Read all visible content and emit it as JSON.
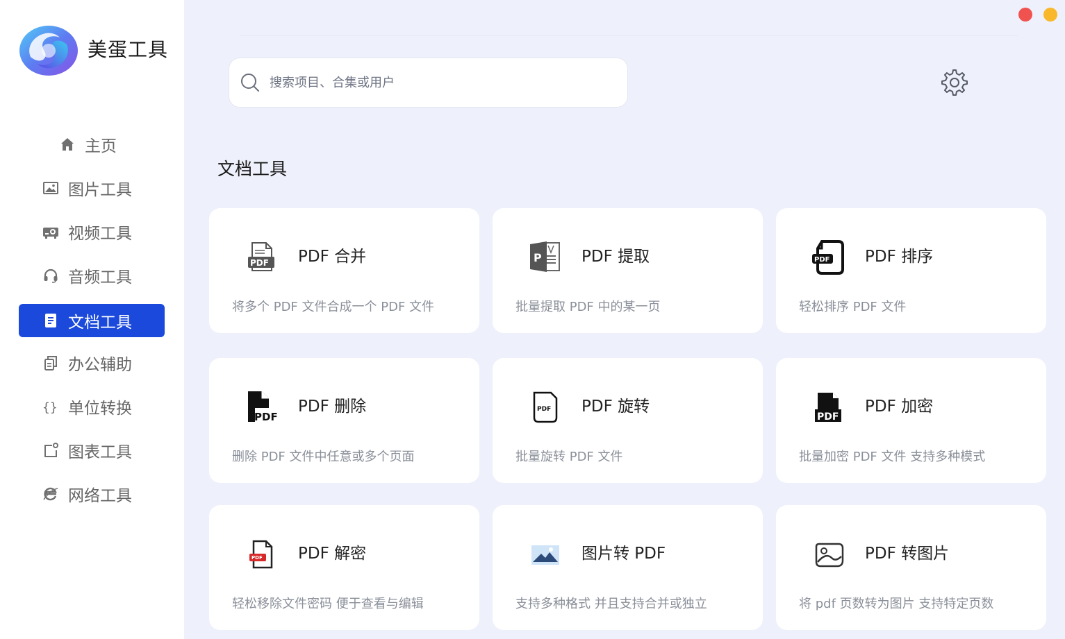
{
  "app": {
    "title": "美蛋工具"
  },
  "nav": [
    {
      "label": "主页",
      "icon": "home-icon"
    },
    {
      "label": "图片工具",
      "icon": "image-icon"
    },
    {
      "label": "视频工具",
      "icon": "video-icon"
    },
    {
      "label": "音频工具",
      "icon": "headphones-icon"
    },
    {
      "label": "文档工具",
      "icon": "document-icon",
      "active": true
    },
    {
      "label": "办公辅助",
      "icon": "copy-icon"
    },
    {
      "label": "单位转换",
      "icon": "braces-icon"
    },
    {
      "label": "图表工具",
      "icon": "chart-icon"
    },
    {
      "label": "网络工具",
      "icon": "browser-icon"
    }
  ],
  "search": {
    "placeholder": "搜索项目、合集或用户"
  },
  "section": {
    "title": "文档工具"
  },
  "tools": [
    {
      "title": "PDF 合并",
      "desc": "将多个 PDF 文件合成一个 PDF 文件",
      "icon": "pdf-merge-icon"
    },
    {
      "title": "PDF 提取",
      "desc": "批量提取 PDF 中的某一页",
      "icon": "pdf-extract-icon"
    },
    {
      "title": "PDF 排序",
      "desc": "轻松排序 PDF 文件",
      "icon": "pdf-sort-icon"
    },
    {
      "title": "PDF 删除",
      "desc": "删除 PDF 文件中任意或多个页面",
      "icon": "pdf-delete-icon"
    },
    {
      "title": "PDF 旋转",
      "desc": "批量旋转 PDF 文件",
      "icon": "pdf-rotate-icon"
    },
    {
      "title": "PDF 加密",
      "desc": "批量加密 PDF 文件 支持多种模式",
      "icon": "pdf-encrypt-icon"
    },
    {
      "title": "PDF 解密",
      "desc": "轻松移除文件密码 便于查看与编辑",
      "icon": "pdf-decrypt-icon"
    },
    {
      "title": "图片转 PDF",
      "desc": "支持多种格式 并且支持合并或独立",
      "icon": "image-to-pdf-icon"
    },
    {
      "title": "PDF 转图片",
      "desc": "将 pdf 页数转为图片 支持特定页数",
      "icon": "pdf-to-image-icon"
    }
  ],
  "colors": {
    "accent": "#1a49dc",
    "background": "#eef1fb",
    "close": "#f0524f",
    "minimize": "#f9b82b"
  }
}
